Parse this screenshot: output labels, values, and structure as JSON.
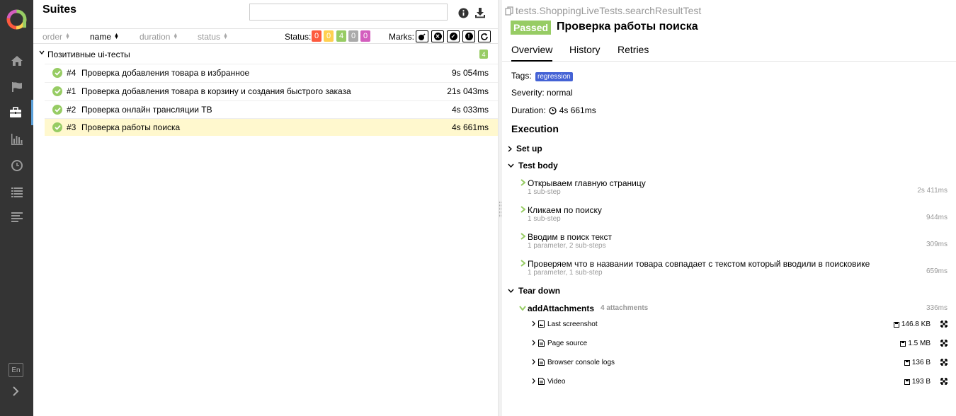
{
  "sidebar": {
    "items": [
      {
        "name": "home-icon"
      },
      {
        "name": "flag-icon"
      },
      {
        "name": "briefcase-icon",
        "active": true
      },
      {
        "name": "bar-chart-icon"
      },
      {
        "name": "clock-icon"
      },
      {
        "name": "list-icon"
      },
      {
        "name": "lines-icon"
      }
    ],
    "language": "En"
  },
  "left": {
    "title": "Suites",
    "search_value": "",
    "sort_columns": [
      {
        "label": "order",
        "active": false
      },
      {
        "label": "name",
        "active": true
      },
      {
        "label": "duration",
        "active": false
      },
      {
        "label": "status",
        "active": false
      }
    ],
    "status_label": "Status:",
    "status_counts": [
      {
        "value": "0",
        "color": "#fd5a3e"
      },
      {
        "value": "0",
        "color": "#ffd050"
      },
      {
        "value": "4",
        "color": "#97cc64"
      },
      {
        "value": "0",
        "color": "#aaaaaa"
      },
      {
        "value": "0",
        "color": "#d35ebe"
      }
    ],
    "marks_label": "Marks:",
    "group": {
      "name": "Позитивные ui-тесты",
      "count": "4"
    },
    "tests": [
      {
        "num": "#4",
        "name": "Проверка добавления товара в избранное",
        "duration": "9s 054ms",
        "selected": false
      },
      {
        "num": "#1",
        "name": "Проверка добавления товара в корзину и создания быстрого заказа",
        "duration": "21s 043ms",
        "selected": false
      },
      {
        "num": "#2",
        "name": "Проверка онлайн трансляции ТВ",
        "duration": "4s 033ms",
        "selected": false
      },
      {
        "num": "#3",
        "name": "Проверка работы поиска",
        "duration": "4s 661ms",
        "selected": true
      }
    ]
  },
  "right": {
    "full_name": "tests.ShoppingLiveTests.searchResultTest",
    "status": "Passed",
    "title": "Проверка работы поиска",
    "tabs": [
      "Overview",
      "History",
      "Retries"
    ],
    "tags_label": "Tags:",
    "tag": "regression",
    "severity": "Severity: normal",
    "duration_label": "Duration:",
    "duration_value": "4s 661ms",
    "execution_title": "Execution",
    "setup_label": "Set up",
    "body_label": "Test body",
    "steps": [
      {
        "name": "Открываем главную страницу",
        "sub": "1 sub-step",
        "duration": "2s 411ms"
      },
      {
        "name": "Кликаем по поиску",
        "sub": "1 sub-step",
        "duration": "944ms"
      },
      {
        "name": "Вводим в поиск текст",
        "sub": "1 parameter, 2 sub-steps",
        "duration": "309ms"
      },
      {
        "name": "Проверяем что в названии товара совпадает с текстом который вводили в поисковике",
        "sub": "1 parameter, 1 sub-step",
        "duration": "659ms"
      }
    ],
    "teardown_label": "Tear down",
    "attachments_parent": {
      "name": "addAttachments",
      "count": "4 attachments",
      "duration": "336ms"
    },
    "attachments": [
      {
        "name": "Last screenshot",
        "size": "146.8 KB",
        "icon": "image-icon"
      },
      {
        "name": "Page source",
        "size": "1.5 MB",
        "icon": "file-icon"
      },
      {
        "name": "Browser console logs",
        "size": "136 B",
        "icon": "file-icon"
      },
      {
        "name": "Video",
        "size": "193 B",
        "icon": "file-icon"
      }
    ]
  }
}
